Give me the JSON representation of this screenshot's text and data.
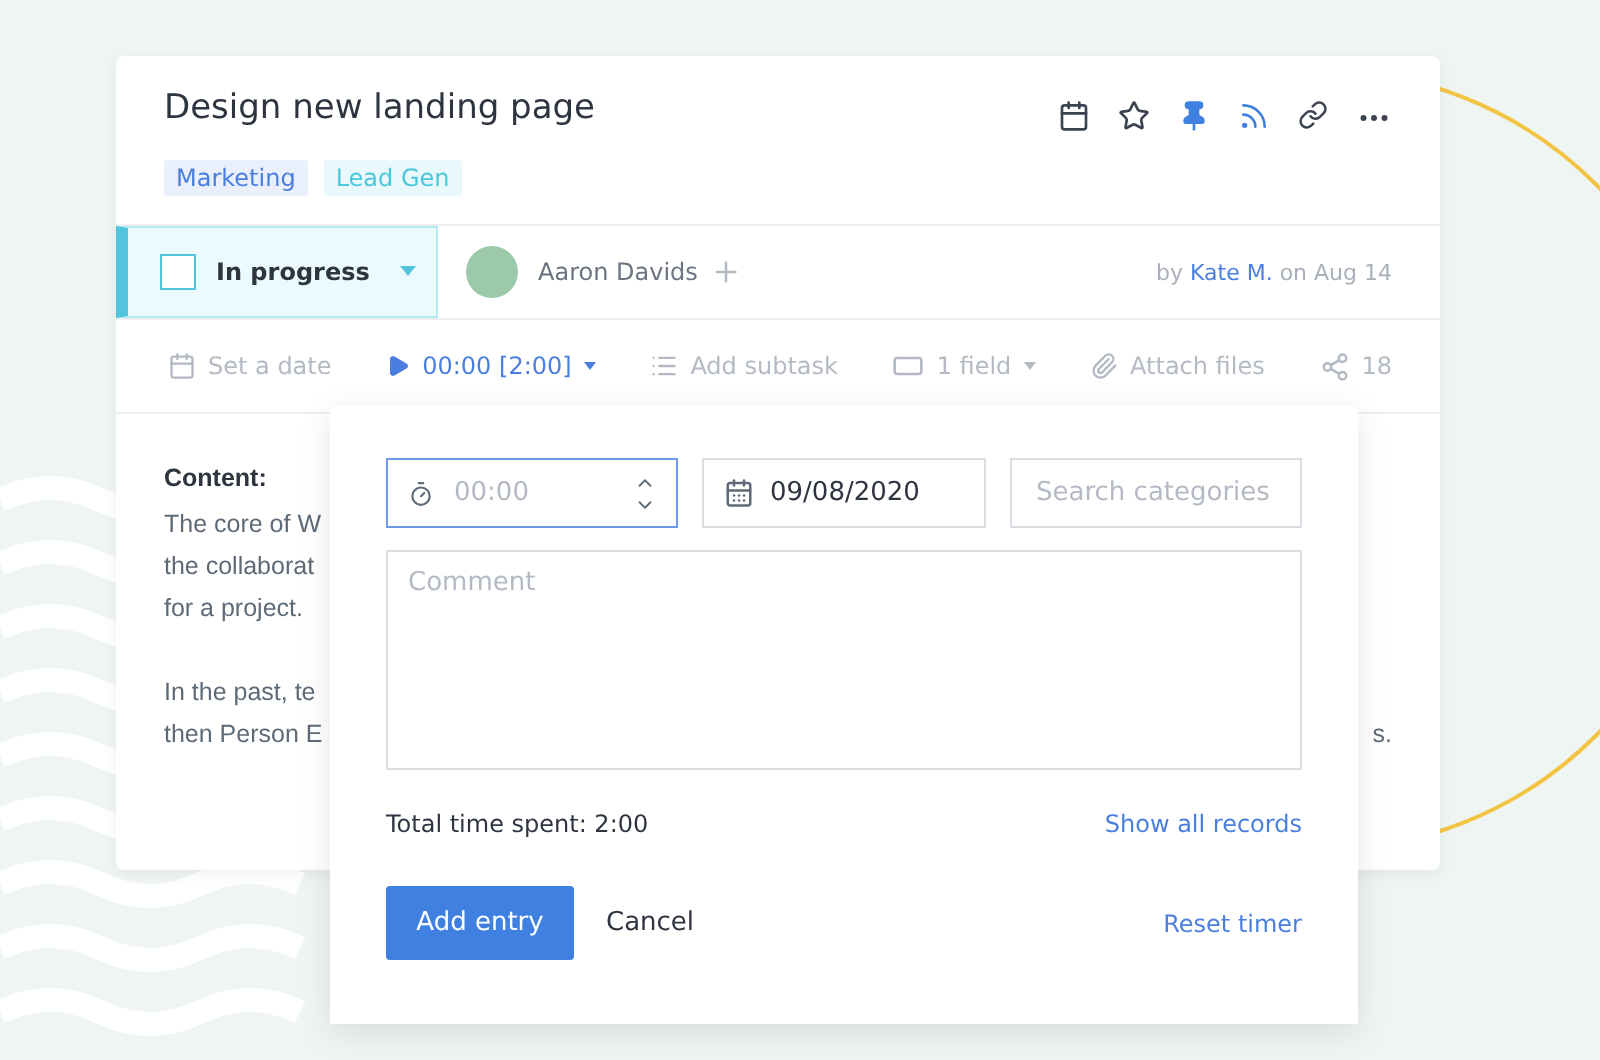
{
  "task": {
    "title": "Design new landing page",
    "tags": [
      {
        "label": "Marketing",
        "color": "#4a7fe0"
      },
      {
        "label": "Lead Gen",
        "color": "#4cc8dc"
      }
    ],
    "status": {
      "label": "In progress",
      "checked": false
    },
    "assignee": {
      "name": "Aaron Davids"
    },
    "meta": {
      "prefix": "by",
      "author": "Kate M.",
      "suffix": "on Aug 14"
    },
    "toolbar": [
      {
        "kind": "date",
        "label": "Set a date"
      },
      {
        "kind": "timer",
        "label": "00:00 [2:00]"
      },
      {
        "kind": "subtask",
        "label": "Add subtask"
      },
      {
        "kind": "field",
        "label": "1 field"
      },
      {
        "kind": "attach",
        "label": "Attach files"
      },
      {
        "kind": "share",
        "label": "18"
      }
    ],
    "content": {
      "heading": "Content:",
      "paragraphs": [
        [
          "The core of W",
          "the collaborat",
          "for a project."
        ],
        [
          "In the past, te",
          "then Person E"
        ]
      ],
      "trailing": "s."
    }
  },
  "popup": {
    "time": {
      "placeholder": "00:00"
    },
    "date": {
      "value": "09/08/2020"
    },
    "category": {
      "placeholder": "Search categories"
    },
    "comment": {
      "placeholder": "Comment"
    },
    "total": "Total time spent: 2:00",
    "show_all": "Show all records",
    "add": "Add entry",
    "cancel": "Cancel",
    "reset": "Reset timer"
  }
}
